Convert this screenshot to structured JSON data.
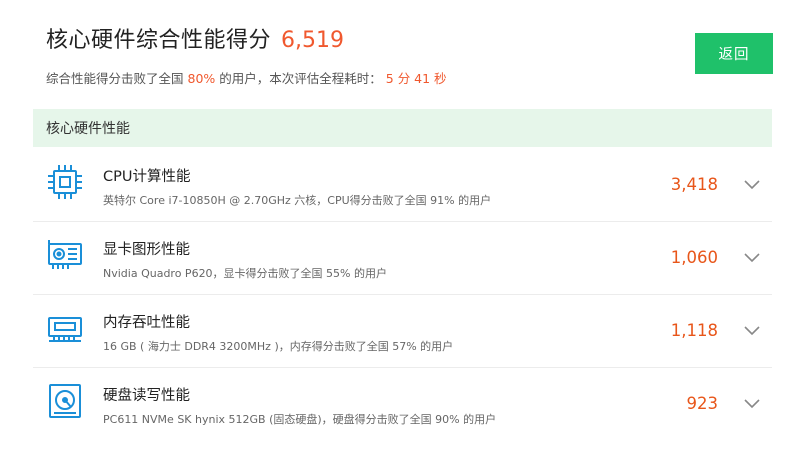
{
  "header": {
    "title": "核心硬件综合性能得分",
    "total_score": "6,519",
    "summary_prefix": "综合性能得分击败了全国",
    "summary_percent": "80%",
    "summary_mid": "的用户，本次评估全程耗时：",
    "summary_time": "5 分 41 秒"
  },
  "back_button": {
    "label": "返回"
  },
  "section": {
    "title": "核心硬件性能"
  },
  "items": [
    {
      "name": "CPU计算性能",
      "desc": "英特尔 Core i7-10850H @ 2.70GHz 六核，CPU得分击败了全国 91% 的用户",
      "score": "3,418",
      "icon": "cpu-icon"
    },
    {
      "name": "显卡图形性能",
      "desc": "Nvidia Quadro P620，显卡得分击败了全国 55% 的用户",
      "score": "1,060",
      "icon": "gpu-icon"
    },
    {
      "name": "内存吞吐性能",
      "desc": "16 GB ( 海力士 DDR4 3200MHz )，内存得分击败了全国 57% 的用户",
      "score": "1,118",
      "icon": "memory-icon"
    },
    {
      "name": "硬盘读写性能",
      "desc": "PC611 NVMe SK hynix 512GB (固态硬盘)，硬盘得分击败了全国 90% 的用户",
      "score": "923",
      "icon": "disk-icon"
    }
  ],
  "colors": {
    "accent": "#1fc16a",
    "score": "#f0582e",
    "icon": "#1a8fd8",
    "section_bg": "#e6f6ea"
  }
}
